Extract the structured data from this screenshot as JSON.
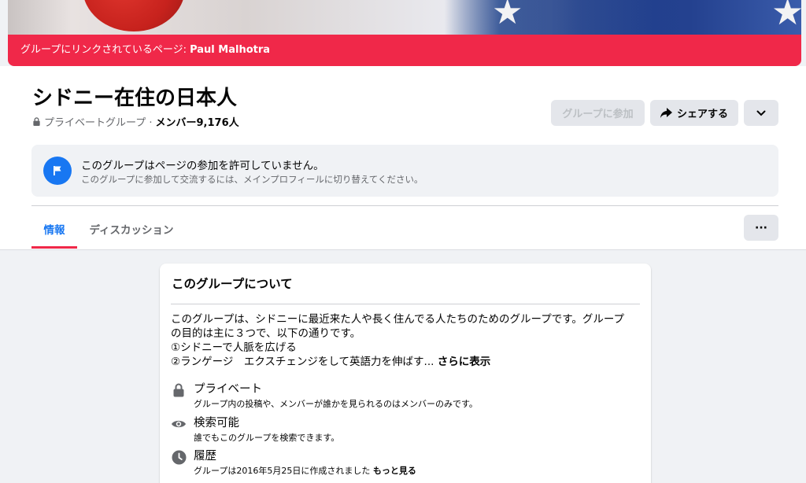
{
  "linked_banner": {
    "prefix": "グループにリンクされているページ: ",
    "page_name": "Paul Malhotra"
  },
  "group": {
    "name": "シドニー在住の日本人",
    "privacy": "プライベートグループ · ",
    "members_label": "メンバー9,176人"
  },
  "actions": {
    "join": "グループに参加",
    "share": "シェアする",
    "more_icon": "chevron-down-icon"
  },
  "notice": {
    "title": "このグループはページの参加を許可していません。",
    "subtitle": "このグループに参加して交流するには、メインプロフィールに切り替えてください。"
  },
  "tabs": [
    {
      "label": "情報",
      "active": true
    },
    {
      "label": "ディスカッション",
      "active": false
    }
  ],
  "tab_menu": "···",
  "about": {
    "heading": "このグループについて",
    "description_lines": [
      "このグループは、シドニーに最近来た人や長く住んでる人たちのためのグループです。グループ",
      "の目的は主に３つで、以下の通りです。",
      "①シドニーで人脈を広げる",
      "②ランゲージ　エクスチェンジをして英語力を伸ばす..."
    ],
    "see_more": "さらに表示",
    "items": [
      {
        "icon": "lock-icon",
        "title": "プライベート",
        "detail": "グループ内の投稿や、メンバーが誰かを見られるのはメンバーのみです。"
      },
      {
        "icon": "eye-icon",
        "title": "検索可能",
        "detail": "誰でもこのグループを検索できます。"
      },
      {
        "icon": "clock-icon",
        "title": "履歴",
        "detail": "グループは2016年5月25日に作成されました ",
        "link": "もっと見る"
      }
    ]
  },
  "colors": {
    "brand_red": "#f02849",
    "accent_blue": "#1877f2",
    "background": "#f0f2f5"
  }
}
